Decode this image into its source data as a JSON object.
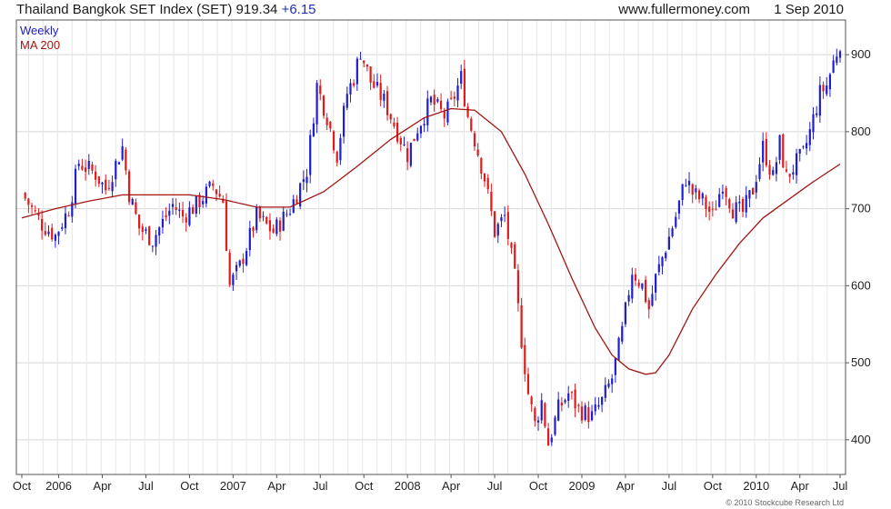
{
  "header": {
    "title": "Thailand Bangkok SET Index (SET) 919.34",
    "change": "+6.15",
    "site": "www.fullermoney.com",
    "date": "1 Sep 2010"
  },
  "footer": "© 2010 Stockcube Research Ltd",
  "colors": {
    "up": "#1f1fd0",
    "down": "#e01b1b",
    "ma": "#a31515",
    "grid": "#d7d7d7",
    "frame": "#555555"
  },
  "chart_data": {
    "type": "candlestick",
    "legend": [
      {
        "label": "Weekly",
        "color": "#2020c0"
      },
      {
        "label": "MA 200",
        "color": "#a31515"
      }
    ],
    "x_tick_labels": [
      "Oct",
      "2006",
      "Apr",
      "Jul",
      "Oct",
      "2007",
      "Apr",
      "Jul",
      "Oct",
      "2008",
      "Apr",
      "Jul",
      "Oct",
      "2009",
      "Apr",
      "Jul",
      "Oct",
      "2010",
      "Apr",
      "Jul"
    ],
    "y_ticks": [
      400,
      500,
      600,
      700,
      800,
      900
    ],
    "ylim": [
      355,
      945
    ],
    "price_path": [
      [
        0,
        720
      ],
      [
        6,
        680
      ],
      [
        10,
        665
      ],
      [
        14,
        700
      ],
      [
        17,
        760
      ],
      [
        22,
        745
      ],
      [
        25,
        725
      ],
      [
        30,
        780
      ],
      [
        32,
        720
      ],
      [
        35,
        675
      ],
      [
        39,
        660
      ],
      [
        45,
        705
      ],
      [
        48,
        690
      ],
      [
        52,
        705
      ],
      [
        57,
        730
      ],
      [
        60,
        710
      ],
      [
        62,
        600
      ],
      [
        65,
        625
      ],
      [
        70,
        690
      ],
      [
        75,
        670
      ],
      [
        80,
        700
      ],
      [
        85,
        750
      ],
      [
        88,
        860
      ],
      [
        91,
        820
      ],
      [
        94,
        770
      ],
      [
        97,
        850
      ],
      [
        99,
        870
      ],
      [
        101,
        905
      ],
      [
        104,
        865
      ],
      [
        108,
        840
      ],
      [
        112,
        800
      ],
      [
        115,
        770
      ],
      [
        118,
        805
      ],
      [
        122,
        840
      ],
      [
        126,
        820
      ],
      [
        128,
        835
      ],
      [
        131,
        870
      ],
      [
        133,
        820
      ],
      [
        135,
        790
      ],
      [
        138,
        740
      ],
      [
        141,
        670
      ],
      [
        144,
        690
      ],
      [
        147,
        610
      ],
      [
        149,
        530
      ],
      [
        151,
        460
      ],
      [
        153,
        420
      ],
      [
        155,
        450
      ],
      [
        157,
        395
      ],
      [
        160,
        440
      ],
      [
        163,
        460
      ],
      [
        166,
        440
      ],
      [
        170,
        430
      ],
      [
        173,
        450
      ],
      [
        176,
        480
      ],
      [
        179,
        540
      ],
      [
        182,
        620
      ],
      [
        185,
        600
      ],
      [
        187,
        570
      ],
      [
        189,
        610
      ],
      [
        192,
        650
      ],
      [
        195,
        690
      ],
      [
        198,
        740
      ],
      [
        200,
        720
      ],
      [
        203,
        710
      ],
      [
        206,
        690
      ],
      [
        209,
        735
      ],
      [
        212,
        700
      ],
      [
        215,
        695
      ],
      [
        218,
        725
      ],
      [
        221,
        780
      ],
      [
        224,
        740
      ],
      [
        226,
        785
      ],
      [
        228,
        740
      ],
      [
        231,
        760
      ],
      [
        233,
        770
      ],
      [
        235,
        800
      ],
      [
        238,
        850
      ],
      [
        240,
        860
      ],
      [
        242,
        890
      ],
      [
        244,
        917
      ]
    ],
    "moving_average_200": [
      [
        0,
        688
      ],
      [
        10,
        700
      ],
      [
        20,
        710
      ],
      [
        30,
        718
      ],
      [
        40,
        718
      ],
      [
        50,
        718
      ],
      [
        60,
        712
      ],
      [
        70,
        702
      ],
      [
        80,
        702
      ],
      [
        90,
        722
      ],
      [
        100,
        755
      ],
      [
        110,
        790
      ],
      [
        120,
        818
      ],
      [
        128,
        830
      ],
      [
        135,
        828
      ],
      [
        143,
        800
      ],
      [
        150,
        745
      ],
      [
        157,
        680
      ],
      [
        164,
        610
      ],
      [
        171,
        545
      ],
      [
        176,
        510
      ],
      [
        181,
        492
      ],
      [
        186,
        485
      ],
      [
        189,
        487
      ],
      [
        193,
        510
      ],
      [
        200,
        570
      ],
      [
        207,
        615
      ],
      [
        214,
        655
      ],
      [
        221,
        688
      ],
      [
        228,
        710
      ],
      [
        236,
        735
      ],
      [
        244,
        758
      ]
    ]
  }
}
